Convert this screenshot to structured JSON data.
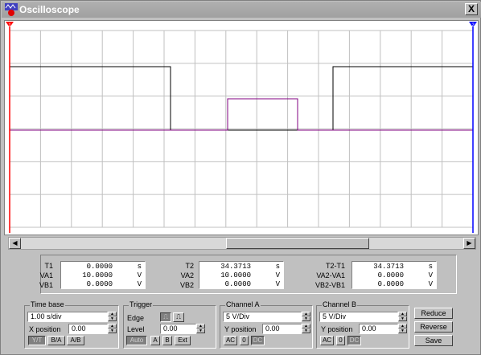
{
  "window": {
    "title": "Oscilloscope",
    "close_label": "X"
  },
  "colors": {
    "trace_a": "#000000",
    "trace_b": "#800080",
    "cursor1": "#ff0000",
    "cursor2": "#0000ff",
    "grid": "#c0c0c0"
  },
  "cursors": {
    "c1_label": "1",
    "c2_label": "2"
  },
  "readouts": {
    "col1": {
      "labels": [
        "T1",
        "VA1",
        "VB1"
      ],
      "values": [
        "0.0000",
        "10.0000",
        "0.0000"
      ],
      "units": [
        "s",
        "V",
        "V"
      ]
    },
    "col2": {
      "labels": [
        "T2",
        "VA2",
        "VB2"
      ],
      "values": [
        "34.3713",
        "10.0000",
        "0.0000"
      ],
      "units": [
        "s",
        "V",
        "V"
      ]
    },
    "col3": {
      "labels": [
        "T2-T1",
        "VA2-VA1",
        "VB2-VB1"
      ],
      "values": [
        "34.3713",
        "0.0000",
        "0.0000"
      ],
      "units": [
        "s",
        "V",
        "V"
      ]
    }
  },
  "timebase": {
    "title": "Time base",
    "scale": "1.00 s/div",
    "xpos_label": "X position",
    "xpos": "0.00",
    "modes": [
      "Y/T",
      "B/A",
      "A/B"
    ]
  },
  "trigger": {
    "title": "Trigger",
    "edge_label": "Edge",
    "level_label": "Level",
    "level": "0.00",
    "sources": [
      "Auto",
      "A",
      "B",
      "Ext"
    ]
  },
  "channel_a": {
    "title": "Channel A",
    "scale": "5  V/Div",
    "ypos_label": "Y position",
    "ypos": "0.00",
    "coupling": [
      "AC",
      "0",
      "DC"
    ]
  },
  "channel_b": {
    "title": "Channel B",
    "scale": "5  V/Div",
    "ypos_label": "Y position",
    "ypos": "0.00",
    "coupling": [
      "AC",
      "0",
      "DC"
    ]
  },
  "buttons": {
    "reduce": "Reduce",
    "reverse": "Reverse",
    "save": "Save"
  }
}
